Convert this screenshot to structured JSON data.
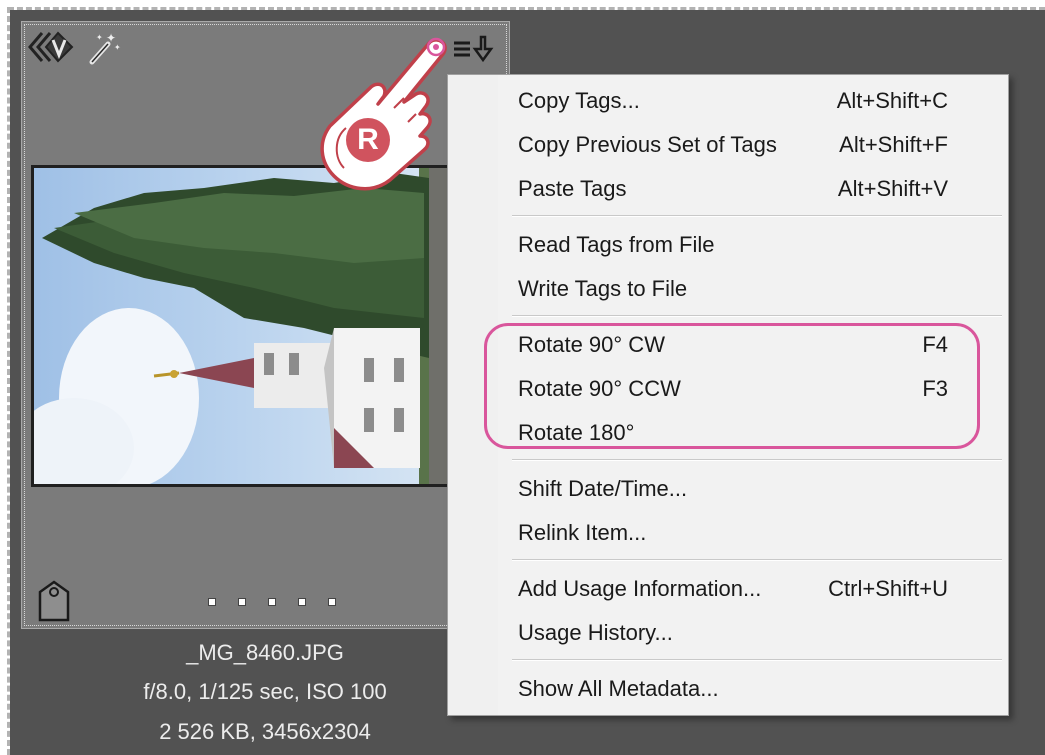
{
  "thumbnail": {
    "file_name": "_MG_8460.JPG",
    "exposure": "f/8.0, 1/125 sec, ISO 100",
    "size_info": "2 526 KB, 3456x2304",
    "rating_dots": 5
  },
  "icons": {
    "version_badge": "version-set-icon",
    "magic": "auto-enhance-icon",
    "menu": "menu-arrow-icon",
    "tag": "tag-icon",
    "hand": "right-click-hand-icon"
  },
  "hand_letter": "R",
  "menu": {
    "groups": [
      [
        {
          "label": "Copy Tags...",
          "shortcut": "Alt+Shift+C"
        },
        {
          "label": "Copy Previous Set of Tags",
          "shortcut": "Alt+Shift+F"
        },
        {
          "label": "Paste Tags",
          "shortcut": "Alt+Shift+V"
        }
      ],
      [
        {
          "label": "Read Tags from File",
          "shortcut": ""
        },
        {
          "label": "Write Tags to File",
          "shortcut": ""
        }
      ],
      [
        {
          "label": "Rotate 90° CW",
          "shortcut": "F4"
        },
        {
          "label": "Rotate 90° CCW",
          "shortcut": "F3"
        },
        {
          "label": "Rotate 180°",
          "shortcut": ""
        }
      ],
      [
        {
          "label": "Shift Date/Time...",
          "shortcut": ""
        },
        {
          "label": "Relink Item...",
          "shortcut": ""
        }
      ],
      [
        {
          "label": "Add Usage Information...",
          "shortcut": "Ctrl+Shift+U"
        },
        {
          "label": "Usage History...",
          "shortcut": ""
        }
      ],
      [
        {
          "label": "Show All Metadata...",
          "shortcut": ""
        }
      ]
    ]
  },
  "colors": {
    "highlight": "#d9569c",
    "hand_outline": "#c0404a",
    "card_bg": "#7b7b7b",
    "panel_bg": "#525252"
  }
}
